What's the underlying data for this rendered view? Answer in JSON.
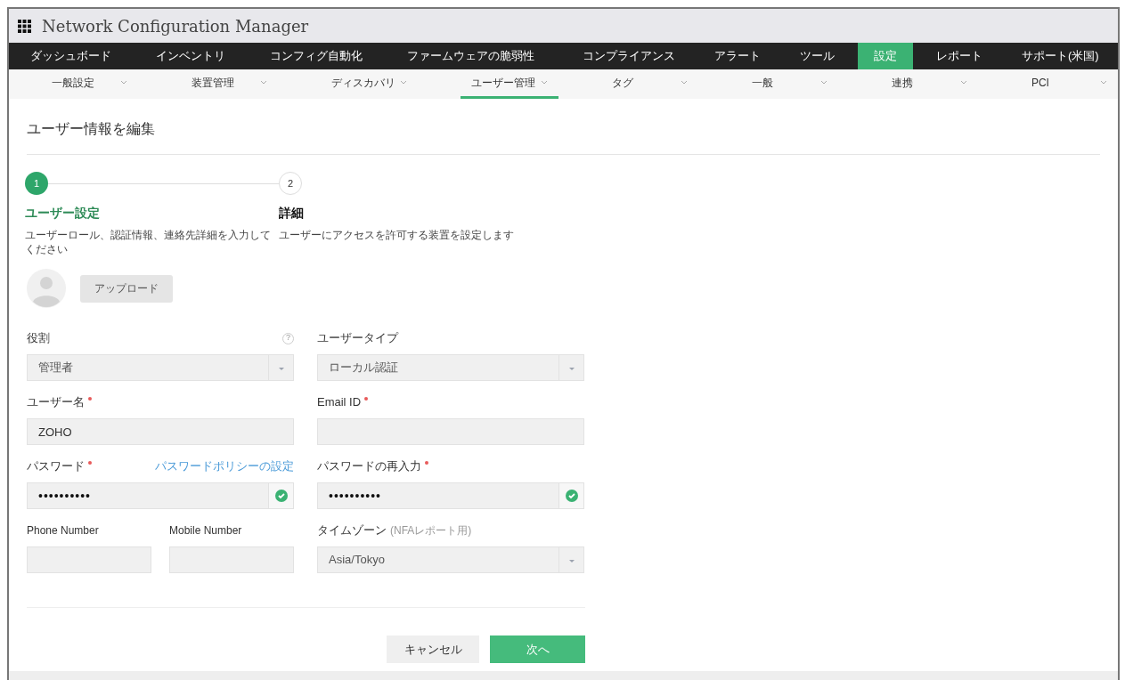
{
  "app": {
    "title": "Network Configuration Manager"
  },
  "main_nav": [
    {
      "label": "ダッシュボード",
      "selected": false
    },
    {
      "label": "インベントリ",
      "selected": false
    },
    {
      "label": "コンフィグ自動化",
      "selected": false
    },
    {
      "label": "ファームウェアの脆弱性",
      "selected": false
    },
    {
      "label": "コンプライアンス",
      "selected": false
    },
    {
      "label": "アラート",
      "selected": false
    },
    {
      "label": "ツール",
      "selected": false
    },
    {
      "label": "設定",
      "selected": true
    },
    {
      "label": "レポート",
      "selected": false
    },
    {
      "label": "サポート(米国)",
      "selected": false
    }
  ],
  "sub_nav": [
    {
      "label": "一般設定",
      "selected": false
    },
    {
      "label": "装置管理",
      "selected": false
    },
    {
      "label": "ディスカバリ",
      "selected": false
    },
    {
      "label": "ユーザー管理",
      "selected": true
    },
    {
      "label": "タグ",
      "selected": false
    },
    {
      "label": "一般",
      "selected": false
    },
    {
      "label": "連携",
      "selected": false
    },
    {
      "label": "PCI",
      "selected": false
    }
  ],
  "page": {
    "heading": "ユーザー情報を編集"
  },
  "steps": [
    {
      "number": "1",
      "title": "ユーザー設定",
      "description": "ユーザーロール、認証情報、連絡先詳細を入力してください",
      "selected": true
    },
    {
      "number": "2",
      "title": "詳細",
      "description": "ユーザーにアクセスを許可する装置を設定します",
      "selected": false
    }
  ],
  "avatar": {
    "upload_button": "アップロード"
  },
  "fields": [
    {
      "kind": "select",
      "label": "役割",
      "help": "?",
      "required": false,
      "value": "管理者"
    },
    {
      "kind": "select",
      "label": "ユーザータイプ",
      "required": false,
      "value": "ローカル認証"
    },
    {
      "kind": "text",
      "label": "ユーザー名",
      "required": true,
      "value": "ZOHO"
    },
    {
      "kind": "text",
      "label": "Email ID",
      "required": true
    },
    {
      "kind": "password",
      "label": "パスワード",
      "required": true,
      "link": "パスワードポリシーの設定",
      "value": "••••••••••",
      "valid": true
    },
    {
      "kind": "password",
      "label": "パスワードの再入力",
      "required": true,
      "value": "••••••••••",
      "valid": true
    },
    {
      "kind": "text",
      "label": "Phone Number",
      "required": false
    },
    {
      "kind": "text",
      "label": "Mobile Number",
      "required": false
    },
    {
      "kind": "select",
      "label": "タイムゾーン",
      "hint": "(NFAレポート用)",
      "required": false,
      "value": "Asia/Tokyo"
    }
  ],
  "buttons": {
    "cancel": "キャンセル",
    "next": "次へ"
  }
}
